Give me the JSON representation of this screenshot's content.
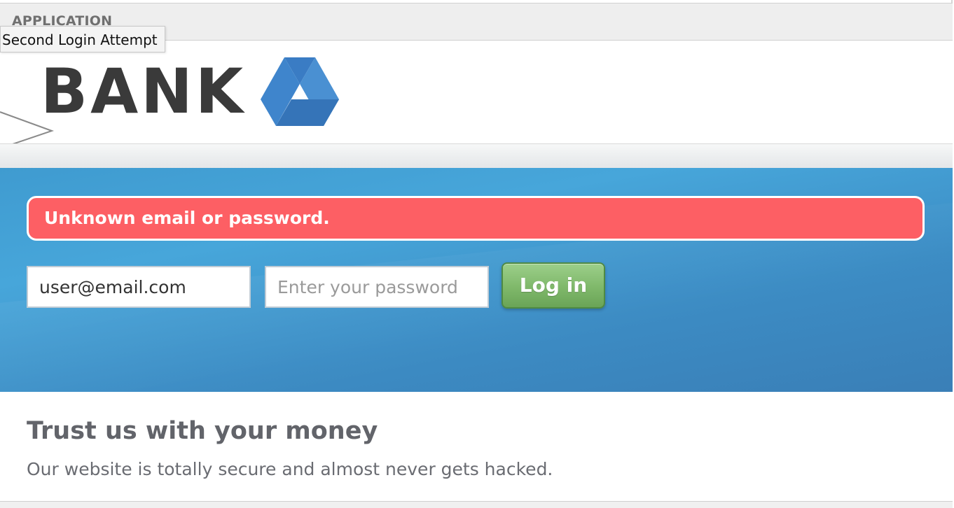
{
  "app": {
    "section_label": "APPLICATION",
    "tooltip": "Second Login Attempt"
  },
  "brand": {
    "name": "BANK",
    "logo_icon": "triangle-logo-icon",
    "logo_color": "#3a7cc4"
  },
  "login": {
    "error_message": "Unknown email or password.",
    "email_value": "user@email.com",
    "email_placeholder": "",
    "password_value": "",
    "password_placeholder": "Enter your password",
    "submit_label": "Log in"
  },
  "content": {
    "title": "Trust us with your money",
    "body": "Our website is totally secure and almost never gets hacked."
  },
  "colors": {
    "error": "#fd5f64",
    "hero": "#43a0d6",
    "button": "#7fb86a",
    "text_heading": "#62646a"
  }
}
